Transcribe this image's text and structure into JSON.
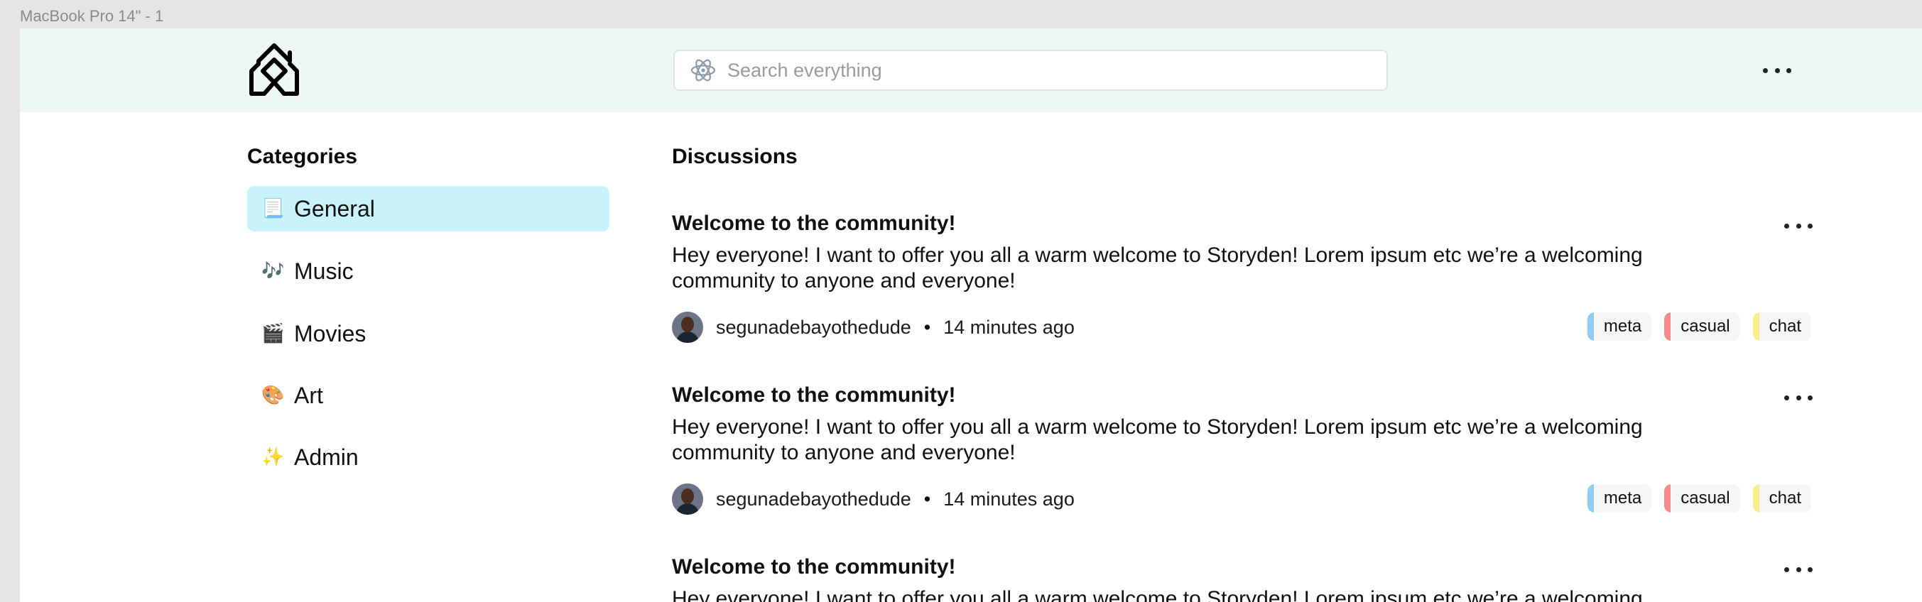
{
  "frame_label": "MacBook Pro 14\" - 1",
  "search": {
    "placeholder": "Search everything",
    "icon": "atom-icon"
  },
  "categories": {
    "heading": "Categories",
    "items": [
      {
        "emoji": "📃",
        "label": "General",
        "active": true
      },
      {
        "emoji": "🎶",
        "label": "Music",
        "active": false
      },
      {
        "emoji": "🎬",
        "label": "Movies",
        "active": false
      },
      {
        "emoji": "🎨",
        "label": "Art",
        "active": false
      },
      {
        "emoji": "✨",
        "label": "Admin",
        "active": false
      }
    ]
  },
  "discussions": {
    "heading": "Discussions",
    "posts": [
      {
        "title": "Welcome to the community!",
        "body": "Hey everyone! I want to offer you all a warm welcome to Storyden! Lorem ipsum etc we’re a welcoming community to anyone and everyone!",
        "author": "segunadebayothedude",
        "separator": "•",
        "time": "14 minutes ago",
        "tags": [
          {
            "label": "meta",
            "color": "#90cdf4"
          },
          {
            "label": "casual",
            "color": "#f48a8a"
          },
          {
            "label": "chat",
            "color": "#f6ee8a"
          }
        ]
      },
      {
        "title": "Welcome to the community!",
        "body": "Hey everyone! I want to offer you all a warm welcome to Storyden! Lorem ipsum etc we’re a welcoming community to anyone and everyone!",
        "author": "segunadebayothedude",
        "separator": "•",
        "time": "14 minutes ago",
        "tags": [
          {
            "label": "meta",
            "color": "#90cdf4"
          },
          {
            "label": "casual",
            "color": "#f48a8a"
          },
          {
            "label": "chat",
            "color": "#f6ee8a"
          }
        ]
      },
      {
        "title": "Welcome to the community!",
        "body": "Hey everyone! I want to offer you all a warm welcome to Storyden! Lorem ipsum etc we’re a welcoming",
        "author": "",
        "separator": "",
        "time": "",
        "tags": []
      }
    ]
  },
  "colors": {
    "topbar": "#edf7f3",
    "active_category": "#c9f3fa"
  }
}
